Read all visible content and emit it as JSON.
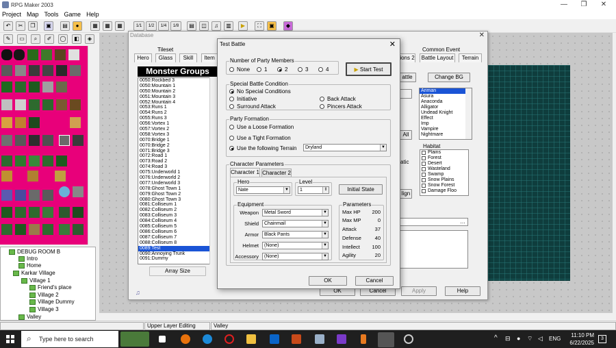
{
  "app": {
    "title": "RPG Maker 2003"
  },
  "menu": [
    "Project",
    "Map",
    "Tools",
    "Game",
    "Help"
  ],
  "toolbar": {
    "icons": [
      "undo-icon",
      "cut-icon",
      "copy-icon",
      "save-icon",
      "paste-icon",
      "delete-icon",
      "layer1-icon",
      "layer2-icon",
      "layer3-icon",
      "zoom11-icon",
      "zoom12-icon",
      "zoom14-icon",
      "zoom18-icon",
      "database-icon",
      "materials-icon",
      "music-icon",
      "script-icon",
      "playtest-icon",
      "fullscreen-icon",
      "title-icon",
      "help-icon"
    ],
    "zoom_labels": [
      "1/1",
      "1/2",
      "1/4",
      "1/8"
    ]
  },
  "tree": {
    "items": [
      "DEBUG ROOM B",
      "Intro",
      "Home",
      "Karkar Village",
      "Village 1",
      "Friend's place",
      "Village 2",
      "Village Dummy",
      "Village 3",
      "Valley"
    ]
  },
  "database": {
    "caption": "Database",
    "tabs": [
      "Hero",
      "Glass",
      "Skill",
      "Item"
    ],
    "section_label": "Tileset",
    "right_tabs": [
      "Common Event",
      "Battle Layout",
      "Terrain"
    ],
    "right_tab_partial": "ions 2",
    "monster_groups_title": "Monster Groups",
    "monster_groups": [
      "0050:Rockbed 3",
      "0050:Mountain 1",
      "0050:Mountain 2",
      "0051:Mountain 3",
      "0052:Mountain 4",
      "0053:Runs 1",
      "0054:Runs 2",
      "0055:Runs 3",
      "0056:Vortex 1",
      "0057:Vortex 2",
      "0058:Vortex 3",
      "0070:Bridge 1",
      "0070:Bridge 2",
      "0071:Bridge 3",
      "0072:Road 1",
      "0073:Road 2",
      "0074:Road 3",
      "0075:Underworld 1",
      "0076:Underworld 2",
      "0077:Underworld 3",
      "0078:Ghost Town 1",
      "0079:Ghost Town 2",
      "0080:Ghost Town 3",
      "0081:Colliseum 1",
      "0082:Colliseum 2",
      "0083:Colliseum 3",
      "0084:Colliseum 4",
      "0085:Colliseum 5",
      "0086:Colliseum 6",
      "0087:Colliseum 7",
      "0088:Colliseum 8",
      "0089:Test",
      "0090:Annoying Trunk",
      "0091:Dummy"
    ],
    "selected_group": "0089:Test",
    "array_size_btn": "Array Size",
    "battle_btn": "attle",
    "change_bg_btn": "Change BG",
    "all_btn": "All",
    "atic_label": "atic",
    "lign_btn": "lign",
    "enemies": [
      "Ariman",
      "Asura",
      "Anaconda",
      "Alligator",
      "Undead Knight",
      "Effect",
      "Imp",
      "Vampire",
      "Nightmare"
    ],
    "selected_enemy": "Ariman",
    "habitat_label": "Habitat",
    "habitats": [
      "Plains",
      "Forest",
      "Desert",
      "Wasteland",
      "Swamp",
      "Snow Plains",
      "Snow Forest",
      "Damage Floo"
    ],
    "ok": "OK",
    "cancel": "Cancel",
    "apply": "Apply",
    "help": "Help"
  },
  "test_battle": {
    "title": "Test Battle",
    "party_members_label": "Number of Party Members",
    "party_options": [
      "None",
      "1",
      "2",
      "3",
      "4"
    ],
    "party_selected": "2",
    "start_test": "Start Test",
    "special_label": "Special Battle Condition",
    "special_options": [
      "No Special Conditions",
      "Initiative",
      "Back Attack",
      "Surround Attack",
      "Pincers Attack"
    ],
    "special_selected": "No Special Conditions",
    "formation_label": "Party Formation",
    "formation_options": [
      "Use a Loose Formation",
      "Use a Tight Formation",
      "Use the following Terrain"
    ],
    "formation_selected": "Use the following Terrain",
    "terrain_value": "Dryland",
    "char_params_label": "Character Parameters",
    "char_tabs": [
      "Character 1",
      "Character 2"
    ],
    "hero_label": "Hero",
    "hero_value": "Nate",
    "level_label": "Level",
    "level_value": "1",
    "initial_state": "Initial State",
    "equipment_label": "Equipment",
    "equipment": [
      {
        "label": "Weapon",
        "value": "Metal Sword"
      },
      {
        "label": "Shield",
        "value": "Chainmail"
      },
      {
        "label": "Armor",
        "value": "Black Pants"
      },
      {
        "label": "Helmet",
        "value": "(None)"
      },
      {
        "label": "Accessory",
        "value": "(None)"
      }
    ],
    "parameters_label": "Parameters",
    "parameters": [
      {
        "label": "Max HP",
        "value": "200"
      },
      {
        "label": "Max MP",
        "value": "0"
      },
      {
        "label": "Attack",
        "value": "37"
      },
      {
        "label": "Defense",
        "value": "40"
      },
      {
        "label": "Intellect",
        "value": "100"
      },
      {
        "label": "Agility",
        "value": "20"
      }
    ],
    "ok": "OK",
    "cancel": "Cancel"
  },
  "status": {
    "mode": "Upper Layer Editing Mode",
    "map": "Valley"
  },
  "taskbar": {
    "search_placeholder": "Type here to search",
    "language": "ENG",
    "time": "11:10 PM",
    "date": "6/22/2025",
    "notifications": "3"
  }
}
